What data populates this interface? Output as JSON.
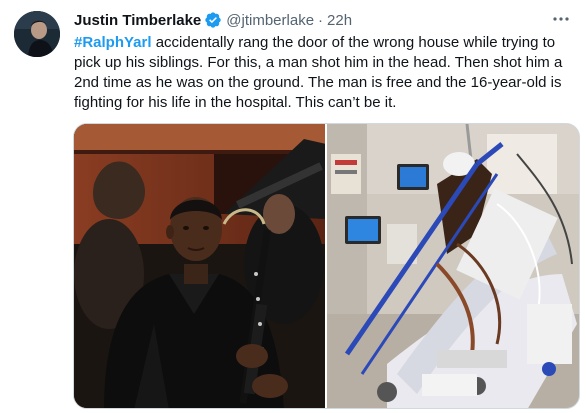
{
  "author": {
    "name": "Justin Timberlake",
    "handle": "@jtimberlake",
    "separator": "·",
    "time": "22h",
    "verified_color": "#1d9bf0"
  },
  "more_icon": "ellipsis-icon",
  "tweet": {
    "hashtag": "#RalphYarl",
    "line1_rest": " accidentally rang the door of the wrong house while trying to",
    "line2": "pick up his siblings. For this, a man shot him in the head. Then shot him a",
    "line3": "2nd time as he was on the ground. The man is free and the 16-year-old is",
    "line4": "fighting for his life in the hospital. This can’t be it."
  },
  "colors": {
    "hashtag": "#1d9bf0",
    "text": "#0f1419",
    "secondary": "#536471",
    "border": "#cfd9de"
  },
  "media": {
    "count": 2
  }
}
